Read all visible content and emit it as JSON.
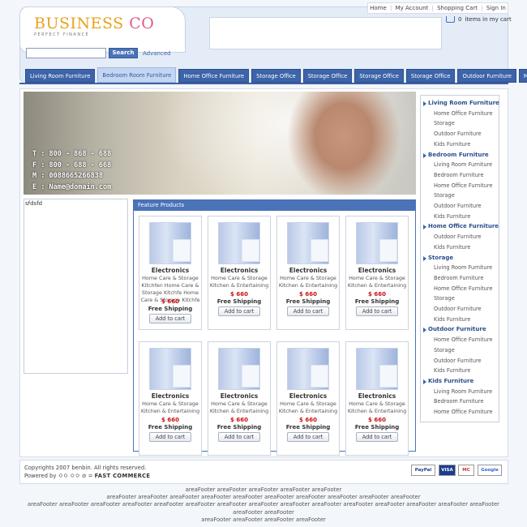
{
  "header": {
    "brand_part1": "BUSINESS",
    "brand_part2": "CO",
    "tagline": "PERFECT FINANCE",
    "toplinks": [
      "Home",
      "My Account",
      "Shopping Cart",
      "Sign In"
    ],
    "cart_count": "0",
    "cart_text": "items in my cart",
    "search_value": "",
    "search_button": "Search",
    "advanced_link": "Advanced"
  },
  "tabs": [
    "Living Room Furniture",
    "Bedroom Room Furniture",
    "Home Office Furniture",
    "Storage Office",
    "Storage Office",
    "Storage Office",
    "Storage Office",
    "Outdoor Furniture",
    "Move"
  ],
  "active_tab_index": 1,
  "hero": {
    "contacts": [
      "T : 800 - 868 - 688",
      "F : 800 - 688 - 668",
      "M : 0088665266838",
      "E : Name@domain.com"
    ]
  },
  "left_box_text": "sfdsfd",
  "feature": {
    "title": "Feature Products",
    "products": [
      {
        "name": "Electronics",
        "desc": "Home Care & Storage Kitchfen Home Care & Storage Kitchfe Home Care & Storage Kitchfe",
        "price": "$ 660",
        "shipping": "Free Shipping",
        "button": "Add to cart"
      },
      {
        "name": "Electronics",
        "desc": "Home Care & Storage Kitchen & Entertaining",
        "price": "$ 660",
        "shipping": "Free Shipping",
        "button": "Add to cart"
      },
      {
        "name": "Electronics",
        "desc": "Home Care & Storage Kitchen & Entertaining",
        "price": "$ 660",
        "shipping": "Free Shipping",
        "button": "Add to cart"
      },
      {
        "name": "Electronics",
        "desc": "Home Care & Storage Kitchen & Entertaining",
        "price": "$ 660",
        "shipping": "Free Shipping",
        "button": "Add to cart"
      },
      {
        "name": "Electronics",
        "desc": "Home Care & Storage Kitchen & Entertaining",
        "price": "$ 660",
        "shipping": "Free Shipping",
        "button": "Add to cart"
      },
      {
        "name": "Electronics",
        "desc": "Home Care & Storage Kitchen & Entertaining",
        "price": "$ 660",
        "shipping": "Free Shipping",
        "button": "Add to cart"
      },
      {
        "name": "Electronics",
        "desc": "Home Care & Storage Kitchen & Entertaining",
        "price": "$ 660",
        "shipping": "Free Shipping",
        "button": "Add to cart"
      },
      {
        "name": "Electronics",
        "desc": "Home Care & Storage Kitchen & Entertaining",
        "price": "$ 660",
        "shipping": "Free Shipping",
        "button": "Add to cart"
      }
    ]
  },
  "sidebar": {
    "categories": [
      {
        "name": "Living Room Furniture",
        "items": [
          "Home Office Furniture",
          "Storage",
          "Outdoor Furniture",
          "Kids Furniture"
        ]
      },
      {
        "name": "Bedroom Furniture",
        "items": [
          "Living Room Furniture",
          "Bedroom Furniture",
          "Home Office Furniture",
          "Storage",
          "Outdoor Furniture",
          "Kids Furniture"
        ]
      },
      {
        "name": "Home Office Furniture",
        "items": [
          "Outdoor Furniture",
          "Kids Furniture"
        ]
      },
      {
        "name": "Storage",
        "items": [
          "Living Room Furniture",
          "Bedroom Furniture",
          "Home Office Furniture",
          "Storage",
          "Outdoor Furniture",
          "Kids Furniture"
        ]
      },
      {
        "name": "Outdoor Furniture",
        "items": [
          "Home Office Furniture",
          "Storage",
          "Outdoor Furniture",
          "Kids Furniture"
        ]
      },
      {
        "name": "Kids Furniture",
        "items": [
          "Living Room Furniture",
          "Bedroom Furniture",
          "Home Office Furniture"
        ]
      }
    ]
  },
  "footer": {
    "copyright": "Copyrights 2007 benbin. All rights reserved.",
    "powered_by": "Powered by",
    "engine": "FAST COMMERCE",
    "payment_badges": [
      "PayPal",
      "VISA",
      "MC",
      "Google"
    ],
    "area_footer_lines": [
      "areaFooter areaFooter areaFooter areaFooter areaFooter",
      "areaFooter areaFooter areaFooter areaFooter areaFooter areaFooter areaFooter areaFooter areaFooter areaFooter",
      "areaFooter areaFooter areaFooter areaFooter areaFooter areaFooter areaFooter areaFooter areaFooter areaFooter areaFooter areaFooter areaFooter areaFooter areaFooter areaFooter areaFooter",
      "areaFooter areaFooter areaFooter areaFooter"
    ]
  }
}
